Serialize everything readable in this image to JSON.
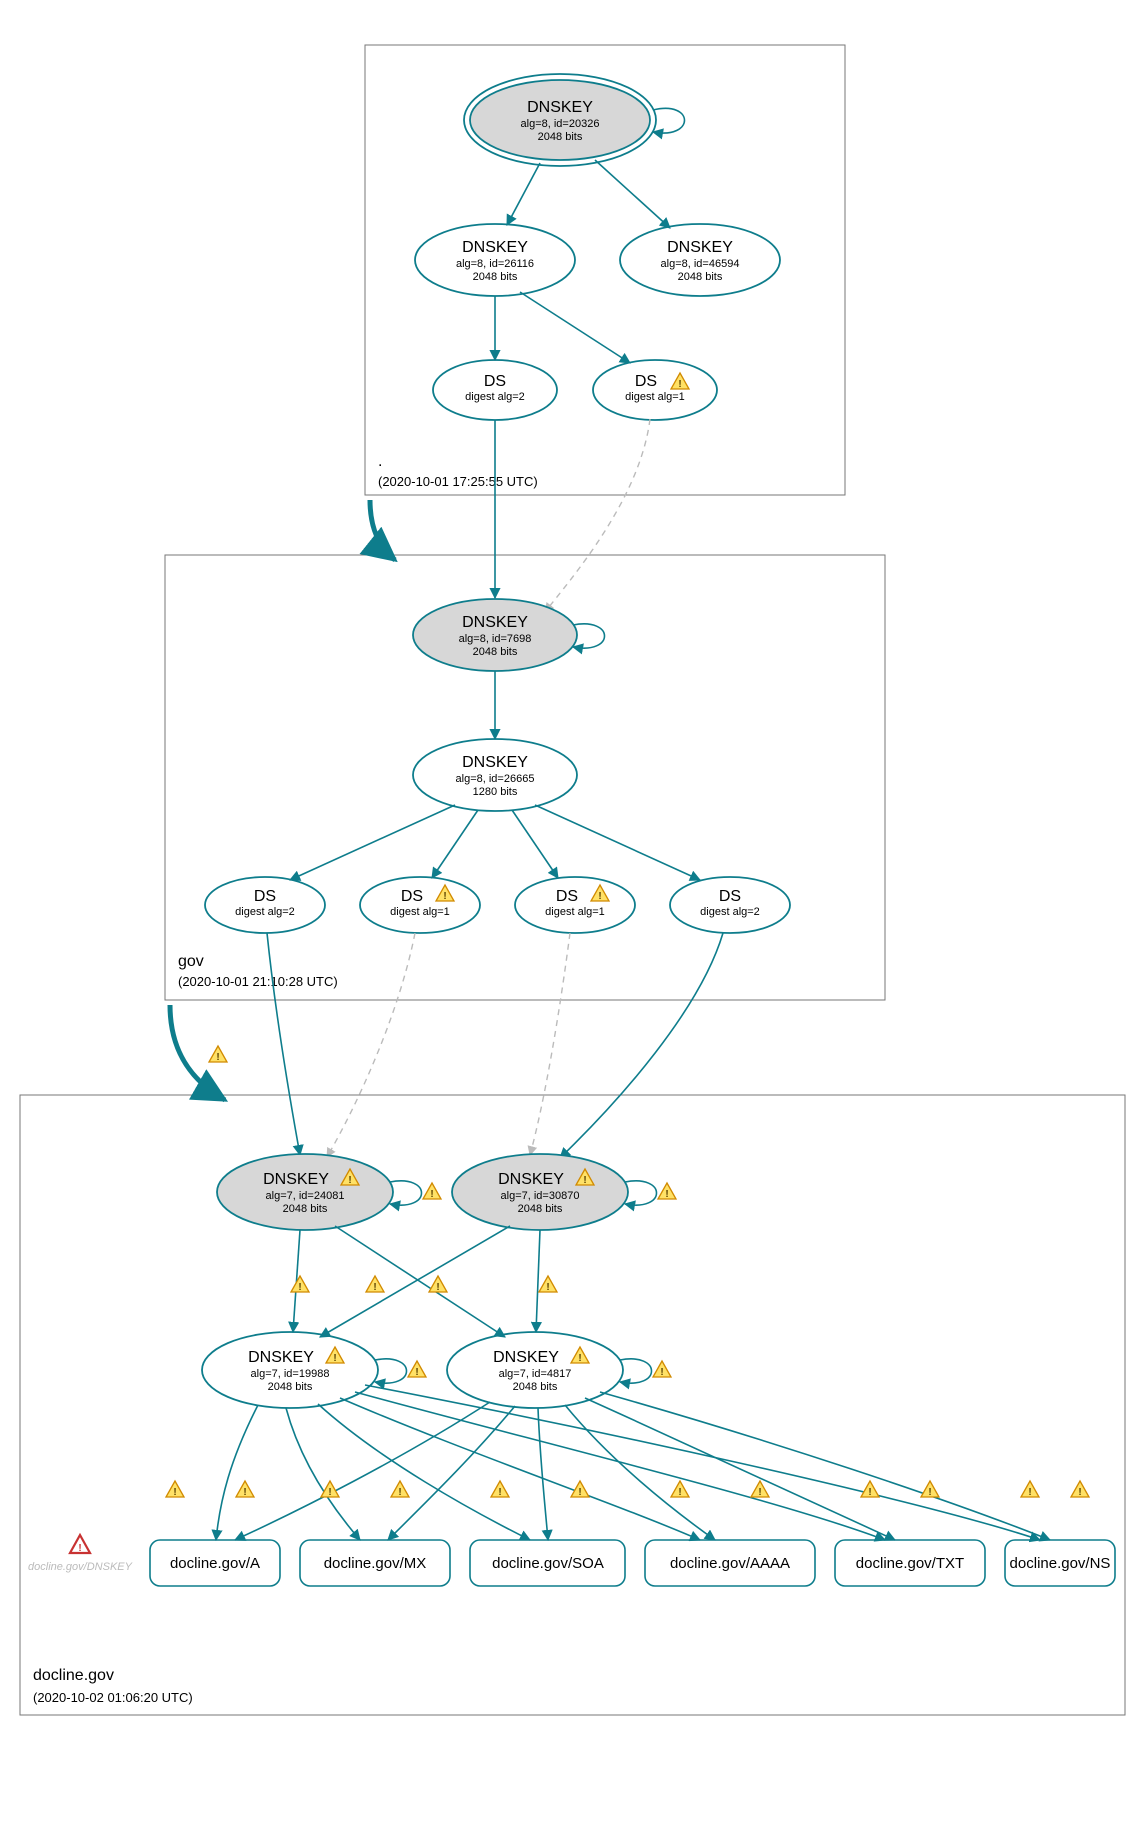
{
  "colors": {
    "edge": "#0e7d8c",
    "warn_fill": "#ffe166",
    "warn_stroke": "#d18a00",
    "err": "#c83232"
  },
  "zones": {
    "root": {
      "name": ".",
      "timestamp": "(2020-10-01 17:25:55 UTC)"
    },
    "gov": {
      "name": "gov",
      "timestamp": "(2020-10-01 21:10:28 UTC)"
    },
    "docline": {
      "name": "docline.gov",
      "timestamp": "(2020-10-02 01:06:20 UTC)"
    }
  },
  "nodes": {
    "root_ksk": {
      "title": "DNSKEY",
      "line2": "alg=8, id=20326",
      "line3": "2048 bits",
      "grey": true,
      "double": true
    },
    "root_zsk1": {
      "title": "DNSKEY",
      "line2": "alg=8, id=26116",
      "line3": "2048 bits"
    },
    "root_zsk2": {
      "title": "DNSKEY",
      "line2": "alg=8, id=46594",
      "line3": "2048 bits"
    },
    "root_ds2": {
      "title": "DS",
      "line2": "digest alg=2"
    },
    "root_ds1": {
      "title": "DS",
      "line2": "digest alg=1",
      "warn": true
    },
    "gov_ksk": {
      "title": "DNSKEY",
      "line2": "alg=8, id=7698",
      "line3": "2048 bits",
      "grey": true
    },
    "gov_zsk": {
      "title": "DNSKEY",
      "line2": "alg=8, id=26665",
      "line3": "1280 bits"
    },
    "gov_ds_a": {
      "title": "DS",
      "line2": "digest alg=2"
    },
    "gov_ds_b": {
      "title": "DS",
      "line2": "digest alg=1",
      "warn": true
    },
    "gov_ds_c": {
      "title": "DS",
      "line2": "digest alg=1",
      "warn": true
    },
    "gov_ds_d": {
      "title": "DS",
      "line2": "digest alg=2"
    },
    "doc_ksk1": {
      "title": "DNSKEY",
      "line2": "alg=7, id=24081",
      "line3": "2048 bits",
      "grey": true,
      "warn": true
    },
    "doc_ksk2": {
      "title": "DNSKEY",
      "line2": "alg=7, id=30870",
      "line3": "2048 bits",
      "grey": true,
      "warn": true
    },
    "doc_zsk1": {
      "title": "DNSKEY",
      "line2": "alg=7, id=19988",
      "line3": "2048 bits",
      "warn": true
    },
    "doc_zsk2": {
      "title": "DNSKEY",
      "line2": "alg=7, id=4817",
      "line3": "2048 bits",
      "warn": true
    }
  },
  "rrsets": {
    "a": "docline.gov/A",
    "mx": "docline.gov/MX",
    "soa": "docline.gov/SOA",
    "aaaa": "docline.gov/AAAA",
    "txt": "docline.gov/TXT",
    "ns": "docline.gov/NS",
    "missing": "docline.gov/DNSKEY"
  }
}
